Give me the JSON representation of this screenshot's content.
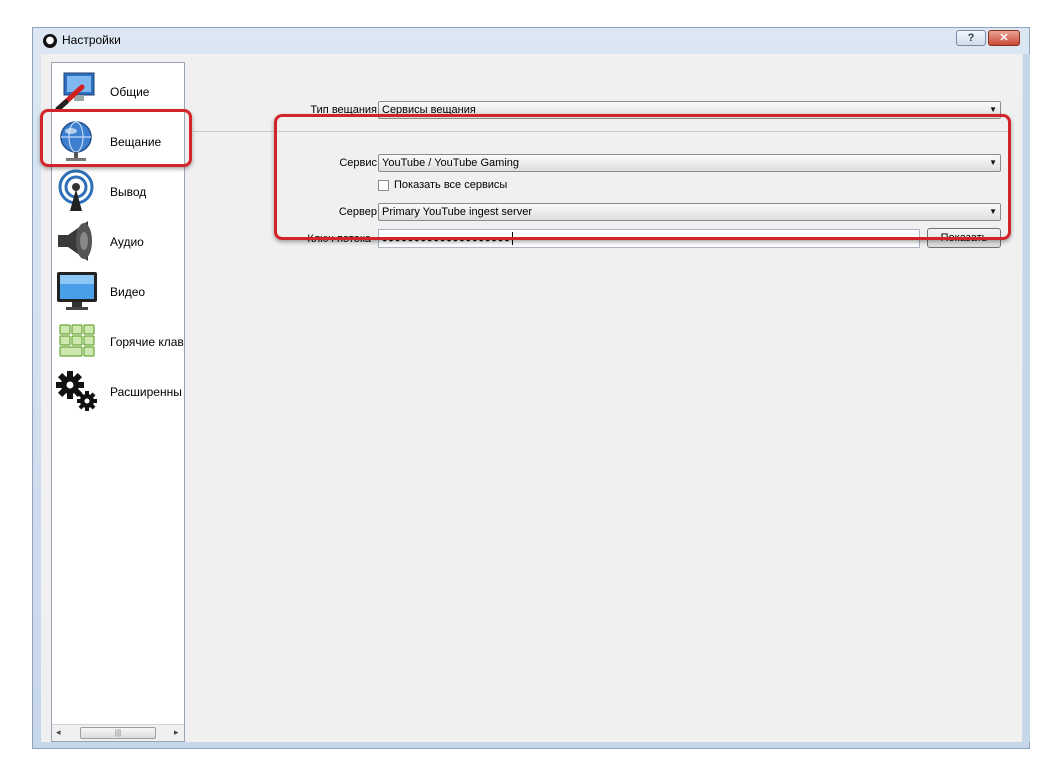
{
  "window": {
    "title": "Настройки",
    "help_label": "?",
    "close_label": "✕"
  },
  "sidebar": {
    "items": [
      {
        "label": "Общие",
        "icon": "general-icon"
      },
      {
        "label": "Вещание",
        "icon": "stream-globe-icon",
        "selected": true
      },
      {
        "label": "Вывод",
        "icon": "output-broadcast-icon"
      },
      {
        "label": "Аудио",
        "icon": "speaker-icon"
      },
      {
        "label": "Видео",
        "icon": "monitor-icon"
      },
      {
        "label": "Горячие клав",
        "icon": "hotkeys-icon"
      },
      {
        "label": "Расширенны",
        "icon": "gears-icon"
      }
    ],
    "scroll_left": "◂",
    "scroll_right": "▸",
    "scroll_grip": "|||"
  },
  "stream": {
    "type_label": "Тип вещания",
    "type_value": "Сервисы вещания",
    "service_label": "Сервис",
    "service_value": "YouTube / YouTube Gaming",
    "show_all_label": "Показать все сервисы",
    "show_all_checked": false,
    "server_label": "Сервер",
    "server_value": "Primary YouTube ingest server",
    "key_label": "Ключ потока",
    "key_value": "●●●●●●●●●●●●●●●●●●●●",
    "show_button": "Показать"
  },
  "colors": {
    "highlight": "#d2242b",
    "window_frame": "#c7d7ea"
  }
}
